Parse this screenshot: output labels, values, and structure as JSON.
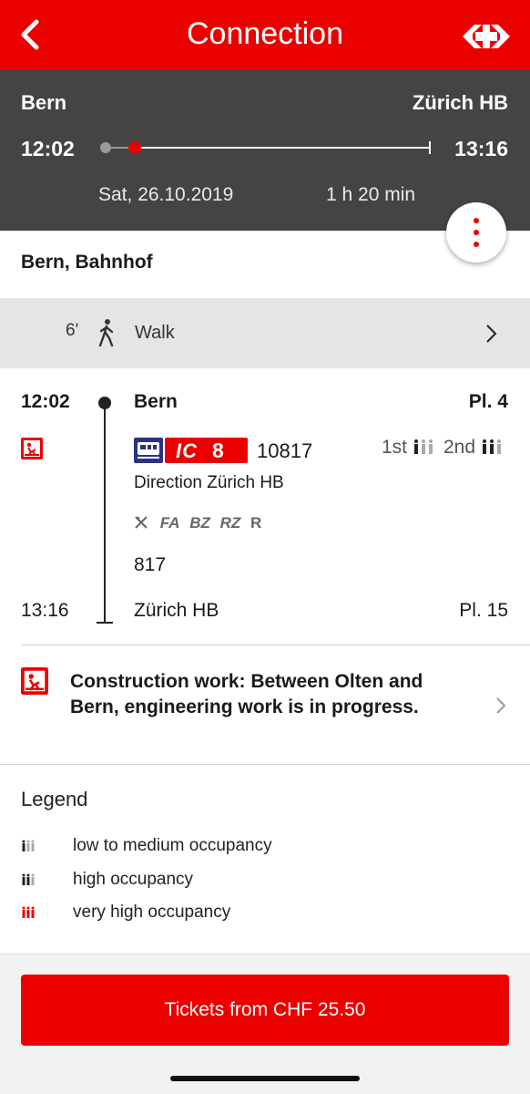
{
  "header": {
    "title": "Connection",
    "back_icon": "chevron-left-icon",
    "logo_icon": "sbb-logo-icon"
  },
  "summary": {
    "from": "Bern",
    "to": "Zürich HB",
    "departure": "12:02",
    "arrival": "13:16",
    "date": "Sat, 26.10.2019",
    "duration": "1 h 20 min"
  },
  "origin": {
    "name": "Bern, Bahnhof"
  },
  "walk": {
    "minutes": "6'",
    "label": "Walk",
    "icon": "walking-person-icon"
  },
  "leg": {
    "departure_time": "12:02",
    "departure_station": "Bern",
    "departure_platform": "Pl. 4",
    "train_type": "IC",
    "line": "8",
    "train_number": "10817",
    "class1": "1st",
    "class2": "2nd",
    "direction": "Direction Zürich HB",
    "attributes": [
      "FA",
      "BZ",
      "RZ",
      "R"
    ],
    "route_number": "817",
    "arrival_time": "13:16",
    "arrival_station": "Zürich HB",
    "arrival_platform": "Pl. 15"
  },
  "notice": {
    "text": "Construction work: Between Olten and Bern, engineering work is in progress."
  },
  "legend": {
    "title": "Legend",
    "items": [
      {
        "label": "low to medium occupancy"
      },
      {
        "label": "high occupancy"
      },
      {
        "label": "very high occupancy"
      }
    ]
  },
  "cta": {
    "label": "Tickets from CHF 25.50"
  },
  "colors": {
    "brand_red": "#eb0000",
    "summary_bg": "#444444",
    "walk_bg": "#e5e5e5"
  }
}
